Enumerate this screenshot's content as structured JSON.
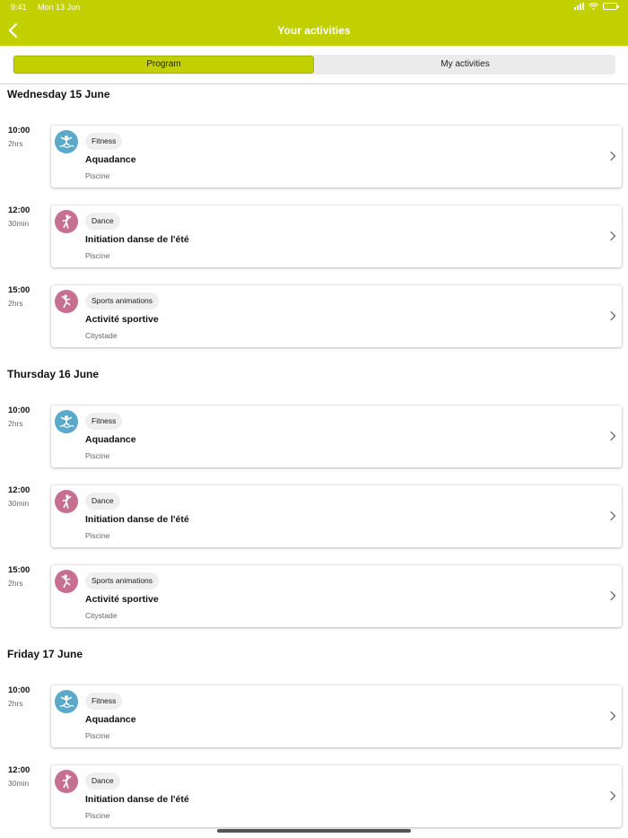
{
  "status_bar": {
    "time": "9:41",
    "date": "Mon 13 Jun"
  },
  "header": {
    "title": "Your activities",
    "back_icon": "chevron-left-icon"
  },
  "segments": [
    {
      "label": "Program",
      "active": true
    },
    {
      "label": "My activities",
      "active": false
    }
  ],
  "colors": {
    "brand": "#c3d000",
    "fitness": "#5aa9c9",
    "dance": "#c66f8e",
    "sports": "#c66f8e"
  },
  "days": [
    {
      "title": "Wednesday 15 June",
      "activities": [
        {
          "time": "10:00",
          "duration": "2hrs",
          "category": "Fitness",
          "icon": "swimmer-icon",
          "name": "Aquadance",
          "place": "Piscine"
        },
        {
          "time": "12:00",
          "duration": "30min",
          "category": "Dance",
          "icon": "dancer-icon",
          "name": "Initiation danse de l'été",
          "place": "Piscine"
        },
        {
          "time": "15:00",
          "duration": "2hrs",
          "category": "Sports animations",
          "icon": "athlete-icon",
          "name": "Activité sportive",
          "place": "Citystade"
        }
      ]
    },
    {
      "title": "Thursday 16 June",
      "activities": [
        {
          "time": "10:00",
          "duration": "2hrs",
          "category": "Fitness",
          "icon": "swimmer-icon",
          "name": "Aquadance",
          "place": "Piscine"
        },
        {
          "time": "12:00",
          "duration": "30min",
          "category": "Dance",
          "icon": "dancer-icon",
          "name": "Initiation danse de l'été",
          "place": "Piscine"
        },
        {
          "time": "15:00",
          "duration": "2hrs",
          "category": "Sports animations",
          "icon": "athlete-icon",
          "name": "Activité sportive",
          "place": "Citystade"
        }
      ]
    },
    {
      "title": "Friday 17 June",
      "activities": [
        {
          "time": "10:00",
          "duration": "2hrs",
          "category": "Fitness",
          "icon": "swimmer-icon",
          "name": "Aquadance",
          "place": "Piscine"
        },
        {
          "time": "12:00",
          "duration": "30min",
          "category": "Dance",
          "icon": "dancer-icon",
          "name": "Initiation danse de l'été",
          "place": "Piscine"
        }
      ]
    }
  ]
}
